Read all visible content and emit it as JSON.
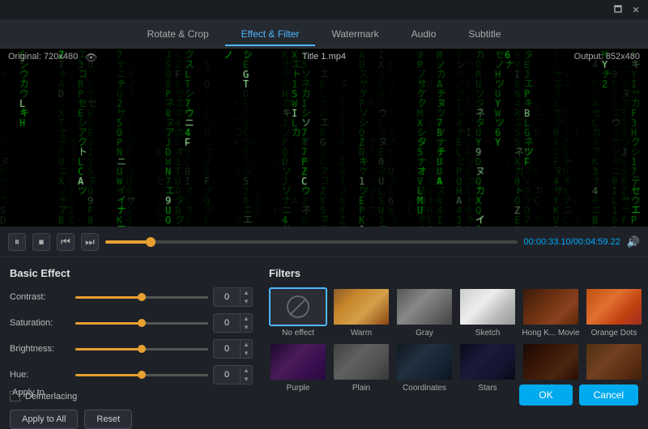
{
  "titlebar": {
    "minimize_label": "🗖",
    "close_label": "✕"
  },
  "tabs": [
    {
      "id": "rotate-crop",
      "label": "Rotate & Crop",
      "active": false
    },
    {
      "id": "effect-filter",
      "label": "Effect & Filter",
      "active": true
    },
    {
      "id": "watermark",
      "label": "Watermark",
      "active": false
    },
    {
      "id": "audio",
      "label": "Audio",
      "active": false
    },
    {
      "id": "subtitle",
      "label": "Subtitle",
      "active": false
    }
  ],
  "preview": {
    "original_label": "Original: 720x480",
    "output_label": "Output: 852x480",
    "title_label": "Title 1.mp4"
  },
  "controls": {
    "time_display": "00:00:33.10/00:04:59.22",
    "progress_percent": 11
  },
  "basic_effect": {
    "title": "Basic Effect",
    "contrast_label": "Contrast:",
    "contrast_value": "0",
    "saturation_label": "Saturation:",
    "saturation_value": "0",
    "brightness_label": "Brightness:",
    "brightness_value": "0",
    "hue_label": "Hue:",
    "hue_value": "0",
    "deinterlacing_label": "Deinterlacing",
    "apply_to_all_label": "Apply to All",
    "reset_label": "Reset",
    "apply_to_label": "Apply to"
  },
  "filters": {
    "title": "Filters",
    "items": [
      {
        "id": "no-effect",
        "label": "No effect",
        "type": "no-effect",
        "active": true
      },
      {
        "id": "warm",
        "label": "Warm",
        "type": "warm",
        "active": false
      },
      {
        "id": "gray",
        "label": "Gray",
        "type": "gray",
        "active": false
      },
      {
        "id": "sketch",
        "label": "Sketch",
        "type": "sketch",
        "active": false
      },
      {
        "id": "hongk-movie",
        "label": "Hong K... Movie",
        "type": "hongk",
        "active": false
      },
      {
        "id": "orange-dots",
        "label": "Orange Dots",
        "type": "orange-dots",
        "active": false
      },
      {
        "id": "purple",
        "label": "Purple",
        "type": "purple",
        "active": false
      },
      {
        "id": "plain",
        "label": "Plain",
        "type": "plain",
        "active": false
      },
      {
        "id": "coordinates",
        "label": "Coordinates",
        "type": "coordinates",
        "active": false
      },
      {
        "id": "stars",
        "label": "Stars",
        "type": "stars",
        "active": false
      },
      {
        "id": "modern",
        "label": "Modern",
        "type": "modern",
        "active": false
      },
      {
        "id": "pixelate",
        "label": "Pixelate",
        "type": "pixelate",
        "active": false
      }
    ]
  },
  "buttons": {
    "ok_label": "OK",
    "cancel_label": "Cancel"
  }
}
